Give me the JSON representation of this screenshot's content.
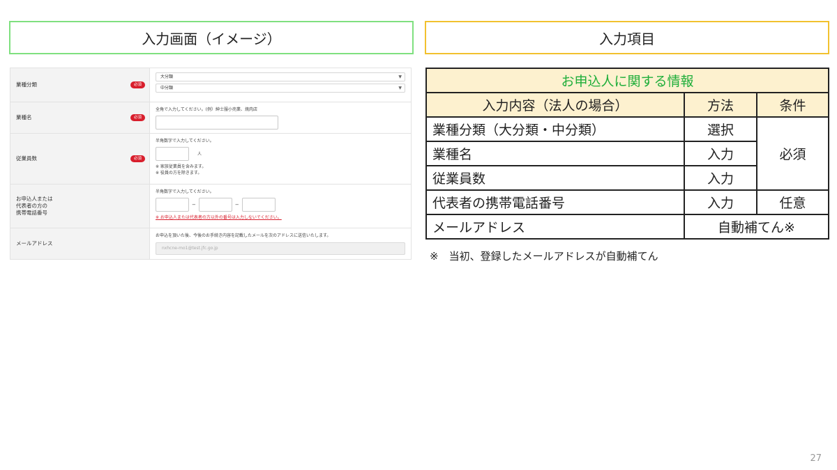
{
  "headers": {
    "left": "入力画面（イメージ）",
    "right": "入力項目"
  },
  "form": {
    "required_badge": "必須",
    "rows": {
      "industry_class": {
        "label": "業種分類",
        "major_select": "大分類",
        "minor_select": "中分類"
      },
      "industry_name": {
        "label": "業種名",
        "hint": "全角で入力してください。(例）紳士服小売業、焼肉店"
      },
      "employees": {
        "label": "従業員数",
        "hint": "半角数字で入力してください。",
        "unit": "人",
        "note1": "※ 家族従業員を含みます。",
        "note2": "※ 役員の方を除きます。"
      },
      "phone": {
        "label_line1": "お申込人または",
        "label_line2": "代表者の方の",
        "label_line3": "携帯電話番号",
        "hint": "半角数字で入力してください。",
        "dash": "−",
        "warning": "※ お申込人または代表者の方以外の番号は入力しないでください。"
      },
      "email": {
        "label": "メールアドレス",
        "hint": "お申込を頂いた後、今後のお手続き内容を記載したメールを次のアドレスに送信いたします。",
        "value": "nxhcne-mo1@test.jfc.go.jp"
      }
    }
  },
  "table": {
    "title": "お申込人に関する情報",
    "col_item": "入力内容（法人の場合）",
    "col_method": "方法",
    "col_condition": "条件",
    "rows": [
      {
        "item": "業種分類（大分類・中分類）",
        "method": "選択"
      },
      {
        "item": "業種名",
        "method": "入力"
      },
      {
        "item": "従業員数",
        "method": "入力"
      },
      {
        "item": "代表者の携帯電話番号",
        "method": "入力",
        "condition": "任意"
      },
      {
        "item": "メールアドレス",
        "method": "自動補てん※"
      }
    ],
    "merged_condition": "必須"
  },
  "footnote": "※　当初、登録したメールアドレスが自動補てん",
  "page_number": "27"
}
